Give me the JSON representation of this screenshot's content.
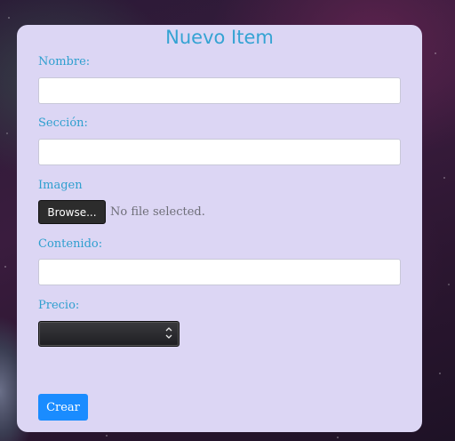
{
  "form": {
    "title": "Nuevo Item",
    "fields": {
      "nombre": {
        "label": "Nombre:",
        "value": ""
      },
      "seccion": {
        "label": "Sección:",
        "value": ""
      },
      "imagen": {
        "label": "Imagen",
        "button_label": "Browse...",
        "status": "No file selected."
      },
      "contenido": {
        "label": "Contenido:",
        "value": ""
      },
      "precio": {
        "label": "Precio:",
        "value": ""
      }
    },
    "submit_label": "Crear"
  },
  "colors": {
    "card_background": "#dcd6f4",
    "accent": "#35a3d3",
    "submit": "#1a8cff"
  },
  "icons": {
    "select_arrows": "up-down-chevron-icon"
  }
}
